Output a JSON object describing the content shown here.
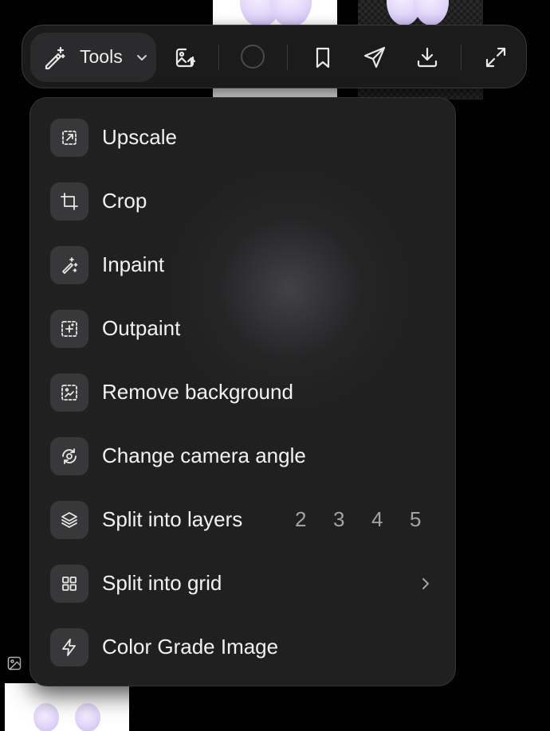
{
  "toolbar": {
    "tools_label": "Tools",
    "icons": [
      "magic-wand-icon",
      "image-upload-icon",
      "color-swatch",
      "bookmark-icon",
      "send-icon",
      "download-icon",
      "expand-icon"
    ]
  },
  "menu": {
    "items": [
      {
        "label": "Upscale",
        "icon": "upscale-icon"
      },
      {
        "label": "Crop",
        "icon": "crop-icon"
      },
      {
        "label": "Inpaint",
        "icon": "inpaint-icon"
      },
      {
        "label": "Outpaint",
        "icon": "outpaint-icon"
      },
      {
        "label": "Remove background",
        "icon": "remove-background-icon"
      },
      {
        "label": "Change camera angle",
        "icon": "camera-angle-icon"
      },
      {
        "label": "Split into layers",
        "icon": "layers-icon",
        "options": [
          "2",
          "3",
          "4",
          "5"
        ]
      },
      {
        "label": "Split into grid",
        "icon": "grid-icon",
        "has_submenu": true
      },
      {
        "label": "Color Grade Image",
        "icon": "lightning-icon"
      }
    ]
  },
  "colors": {
    "background": "#000000",
    "toolbar_bg": "#1b1b1c",
    "menu_bg": "#202021",
    "icon_box": "#38383a",
    "text": "#f2f2f2",
    "muted_text": "#a3a3a7",
    "accent_lavender": "#e5dafb"
  }
}
